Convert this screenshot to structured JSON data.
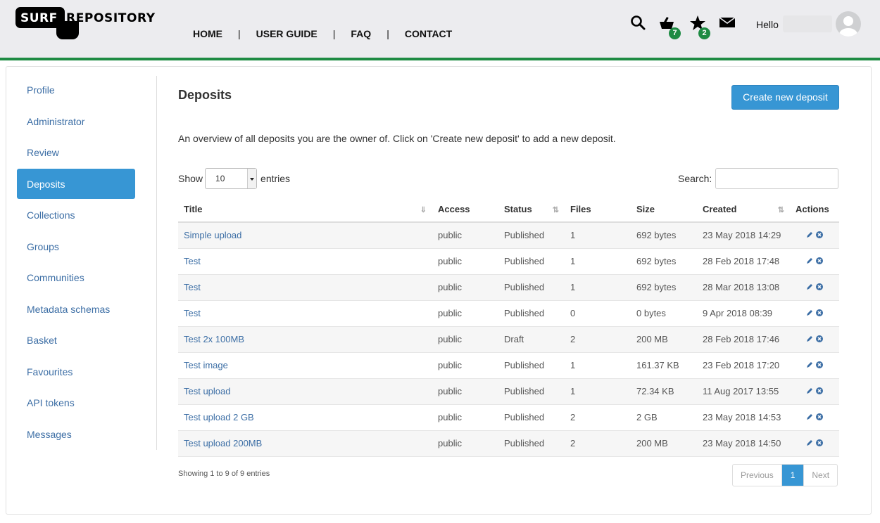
{
  "header": {
    "logo": {
      "part1": "SURF",
      "part2": "REPOSITORY"
    },
    "nav": [
      "HOME",
      "USER GUIDE",
      "FAQ",
      "CONTACT"
    ],
    "separator": "|",
    "basket_count": "7",
    "favourites_count": "2",
    "greeting": "Hello",
    "icons": [
      "search-icon",
      "basket-icon",
      "star-icon",
      "mail-icon",
      "avatar"
    ],
    "accent_color": "#1e8b43"
  },
  "sidebar": {
    "items": [
      {
        "label": "Profile",
        "active": false
      },
      {
        "label": "Administrator",
        "active": false
      },
      {
        "label": "Review",
        "active": false
      },
      {
        "label": "Deposits",
        "active": true
      },
      {
        "label": "Collections",
        "active": false
      },
      {
        "label": "Groups",
        "active": false
      },
      {
        "label": "Communities",
        "active": false
      },
      {
        "label": "Metadata schemas",
        "active": false
      },
      {
        "label": "Basket",
        "active": false
      },
      {
        "label": "Favourites",
        "active": false
      },
      {
        "label": "API tokens",
        "active": false
      },
      {
        "label": "Messages",
        "active": false
      }
    ],
    "active_color": "#3796d4"
  },
  "main": {
    "title": "Deposits",
    "create_button": "Create new deposit",
    "intro": "An overview of all deposits you are the owner of. Click on 'Create new deposit' to add a new deposit.",
    "show_label": "Show",
    "entries_label": "entries",
    "page_size": "10",
    "search_label": "Search:",
    "search_value": "",
    "columns": [
      "Title",
      "Access",
      "Status",
      "Files",
      "Size",
      "Created",
      "Actions"
    ],
    "rows": [
      {
        "title": "Simple upload",
        "access": "public",
        "status": "Published",
        "files": "1",
        "size": "692 bytes",
        "created": "23 May 2018 14:29"
      },
      {
        "title": "Test",
        "access": "public",
        "status": "Published",
        "files": "1",
        "size": "692 bytes",
        "created": "28 Feb 2018 17:48"
      },
      {
        "title": "Test",
        "access": "public",
        "status": "Published",
        "files": "1",
        "size": "692 bytes",
        "created": "28 Mar 2018 13:08"
      },
      {
        "title": "Test",
        "access": "public",
        "status": "Published",
        "files": "0",
        "size": "0 bytes",
        "created": "9 Apr 2018 08:39"
      },
      {
        "title": "Test 2x 100MB",
        "access": "public",
        "status": "Draft",
        "files": "2",
        "size": "200 MB",
        "created": "28 Feb 2018 17:46"
      },
      {
        "title": "Test image",
        "access": "public",
        "status": "Published",
        "files": "1",
        "size": "161.37 KB",
        "created": "23 Feb 2018 17:20"
      },
      {
        "title": "Test upload",
        "access": "public",
        "status": "Published",
        "files": "1",
        "size": "72.34 KB",
        "created": "11 Aug 2017 13:55"
      },
      {
        "title": "Test upload 2 GB",
        "access": "public",
        "status": "Published",
        "files": "2",
        "size": "2 GB",
        "created": "23 May 2018 14:53"
      },
      {
        "title": "Test upload 200MB",
        "access": "public",
        "status": "Published",
        "files": "2",
        "size": "200 MB",
        "created": "23 May 2018 14:50"
      }
    ],
    "info": "Showing 1 to 9 of 9 entries",
    "pager": {
      "prev": "Previous",
      "current": "1",
      "next": "Next"
    }
  }
}
